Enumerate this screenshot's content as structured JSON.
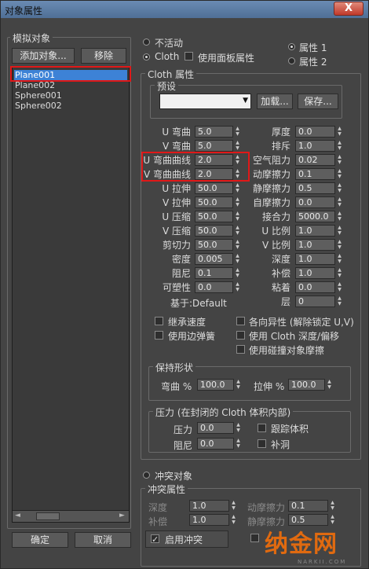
{
  "window": {
    "title": "对象属性",
    "close": "X"
  },
  "left": {
    "group_label": "模拟对象",
    "add_button": "添加对象...",
    "remove_button": "移除",
    "objects": [
      "Plane001",
      "Plane002",
      "Sphere001",
      "Sphere002"
    ],
    "ok_button": "确定",
    "cancel_button": "取消"
  },
  "modes": {
    "inactive": "不活动",
    "cloth": "Cloth",
    "use_panel": "使用面板属性",
    "prop1": "属性 1",
    "prop2": "属性 2"
  },
  "cloth": {
    "group_label": "Cloth 属性",
    "preset_label": "预设",
    "load_button": "加载...",
    "save_button": "保存...",
    "left_params": [
      {
        "label": "U 弯曲",
        "value": "5.0"
      },
      {
        "label": "V 弯曲",
        "value": "5.0"
      },
      {
        "label": "U 弯曲曲线",
        "value": "2.0"
      },
      {
        "label": "V 弯曲曲线",
        "value": "2.0"
      },
      {
        "label": "U 拉伸",
        "value": "50.0"
      },
      {
        "label": "V 拉伸",
        "value": "50.0"
      },
      {
        "label": "U 压缩",
        "value": "50.0"
      },
      {
        "label": "V 压缩",
        "value": "50.0"
      },
      {
        "label": "剪切力",
        "value": "50.0"
      },
      {
        "label": "密度",
        "value": "0.005"
      },
      {
        "label": "阻尼",
        "value": "0.1"
      },
      {
        "label": "可塑性",
        "value": "0.0"
      }
    ],
    "based_on": "基于:Default",
    "right_params": [
      {
        "label": "厚度",
        "value": "0.0"
      },
      {
        "label": "排斥",
        "value": "1.0"
      },
      {
        "label": "空气阻力",
        "value": "0.02"
      },
      {
        "label": "动摩擦力",
        "value": "0.1"
      },
      {
        "label": "静摩擦力",
        "value": "0.5"
      },
      {
        "label": "自摩擦力",
        "value": "0.0"
      },
      {
        "label": "接合力",
        "value": "5000.0"
      },
      {
        "label": "U 比例",
        "value": "1.0"
      },
      {
        "label": "V 比例",
        "value": "1.0"
      },
      {
        "label": "深度",
        "value": "1.0"
      },
      {
        "label": "补偿",
        "value": "1.0"
      },
      {
        "label": "粘着",
        "value": "0.0"
      },
      {
        "label": "层",
        "value": "0"
      }
    ],
    "inherit_velocity": "继承速度",
    "use_edge_springs": "使用边弹簧",
    "anisotropic": "各向异性 (解除锁定 U,V)",
    "use_cloth_depth": "使用 Cloth 深度/偏移",
    "use_collision_friction": "使用碰撞对象摩擦"
  },
  "keep_shape": {
    "group_label": "保持形状",
    "bend_label": "弯曲 %",
    "bend_value": "100.0",
    "stretch_label": "拉伸 %",
    "stretch_value": "100.0"
  },
  "pressure": {
    "group_label": "压力 (在封闭的 Cloth 体积内部)",
    "pressure_label": "压力",
    "pressure_value": "0.0",
    "damping_label": "阻尼",
    "damping_value": "0.0",
    "track_volume": "跟踪体积",
    "cap_holes": "补洞"
  },
  "collision": {
    "radio_label": "冲突对象",
    "group_label": "冲突属性",
    "depth_label": "深度",
    "depth_value": "1.0",
    "offset_label": "补偿",
    "offset_value": "1.0",
    "dyn_friction_label": "动摩擦力",
    "dyn_friction_value": "0.1",
    "static_friction_label": "静摩擦力",
    "static_friction_value": "0.5",
    "enable_collision": "启用冲突"
  }
}
